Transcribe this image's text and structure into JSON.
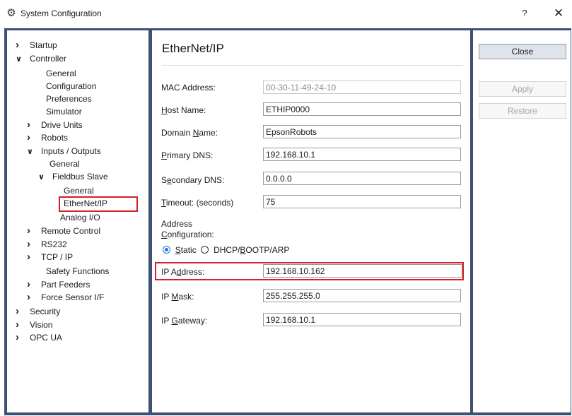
{
  "window": {
    "title": "System Configuration",
    "help_label": "?",
    "close_label": "✕"
  },
  "tree": {
    "items": [
      {
        "label": "Startup",
        "chevron": "›"
      },
      {
        "label": "Controller",
        "chevron": "⌄"
      },
      {
        "label": "General"
      },
      {
        "label": "Configuration"
      },
      {
        "label": "Preferences"
      },
      {
        "label": "Simulator"
      },
      {
        "label": "Drive Units",
        "chevron": "›"
      },
      {
        "label": "Robots",
        "chevron": "›"
      },
      {
        "label": "Inputs / Outputs",
        "chevron": "⌄"
      },
      {
        "label": "General"
      },
      {
        "label": "Fieldbus Slave",
        "chevron": "⌄"
      },
      {
        "label": "General"
      },
      {
        "label": "EtherNet/IP",
        "selected": true
      },
      {
        "label": "Analog I/O"
      },
      {
        "label": "Remote Control",
        "chevron": "›"
      },
      {
        "label": "RS232",
        "chevron": "›"
      },
      {
        "label": "TCP / IP",
        "chevron": "›"
      },
      {
        "label": "Safety Functions"
      },
      {
        "label": "Part Feeders",
        "chevron": "›"
      },
      {
        "label": "Force Sensor I/F",
        "chevron": "›"
      },
      {
        "label": "Security",
        "chevron": "›"
      },
      {
        "label": "Vision",
        "chevron": "›"
      },
      {
        "label": "OPC UA",
        "chevron": "›"
      }
    ]
  },
  "content": {
    "title": "EtherNet/IP",
    "fields": {
      "mac_label": "MAC Address:",
      "mac_value": "00-30-11-49-24-10",
      "host_label": "Host Name:",
      "host_value": "ETHIP0000",
      "domain_label": "Domain Name:",
      "domain_value": "EpsonRobots",
      "primary_dns_label": "Primary DNS:",
      "primary_dns_value": "192.168.10.1",
      "secondary_dns_label": "Secondary DNS:",
      "secondary_dns_value": "0.0.0.0",
      "timeout_label": "Timeout: (seconds)",
      "timeout_value": "75",
      "address_config_label_1": "Address",
      "address_config_label_2": "Configuration:",
      "static_label": "Static",
      "dhcp_label": "DHCP/BOOTP/ARP",
      "ip_address_label": "IP Address:",
      "ip_address_value": "192.168.10.162",
      "ip_mask_label": "IP Mask:",
      "ip_mask_value": "255.255.255.0",
      "ip_gateway_label": "IP Gateway:",
      "ip_gateway_value": "192.168.10.1"
    }
  },
  "buttons": {
    "close": "Close",
    "apply": "Apply",
    "restore": "Restore"
  },
  "colors": {
    "frame": "#3f5173",
    "highlight": "#d61f26",
    "radio_accent": "#1976d2"
  }
}
